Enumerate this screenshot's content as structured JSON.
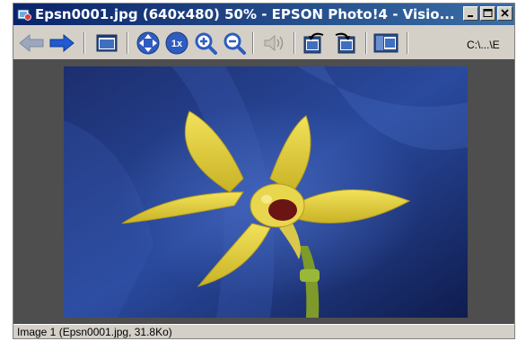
{
  "window": {
    "title": "Epsn0001.jpg (640x480) 50% - EPSON Photo!4 - Visio...",
    "controls": [
      "minimize-icon",
      "maximize-icon",
      "close-icon"
    ]
  },
  "toolbar": {
    "buttons": [
      {
        "name": "back-button",
        "icon": "arrow-left-icon"
      },
      {
        "name": "forward-button",
        "icon": "arrow-right-icon"
      },
      {
        "name": "window-view-button",
        "icon": "window-icon"
      },
      {
        "name": "fit-window-button",
        "icon": "move-arrows-icon"
      },
      {
        "name": "actual-size-button",
        "icon": "one-x-icon",
        "label": "1x"
      },
      {
        "name": "zoom-in-button",
        "icon": "zoom-in-icon"
      },
      {
        "name": "zoom-out-button",
        "icon": "zoom-out-icon"
      },
      {
        "name": "sound-button",
        "icon": "speaker-icon",
        "enabled": false
      },
      {
        "name": "rotate-left-button",
        "icon": "rotate-left-icon"
      },
      {
        "name": "rotate-right-button",
        "icon": "rotate-right-icon"
      },
      {
        "name": "slideshow-button",
        "icon": "slideshow-icon"
      }
    ],
    "path": "C:\\...\\E"
  },
  "image": {
    "subject": "yellow orchid flower on blue background"
  },
  "status": {
    "text": "Image 1 (Epsn0001.jpg, 31.8Ko)"
  },
  "colors": {
    "title_start": "#0a246a",
    "title_end": "#3a6ea5",
    "chrome": "#d4d0c8",
    "viewport_bg": "#4e4e4e",
    "arrow_blue": "#1f5ad1"
  }
}
